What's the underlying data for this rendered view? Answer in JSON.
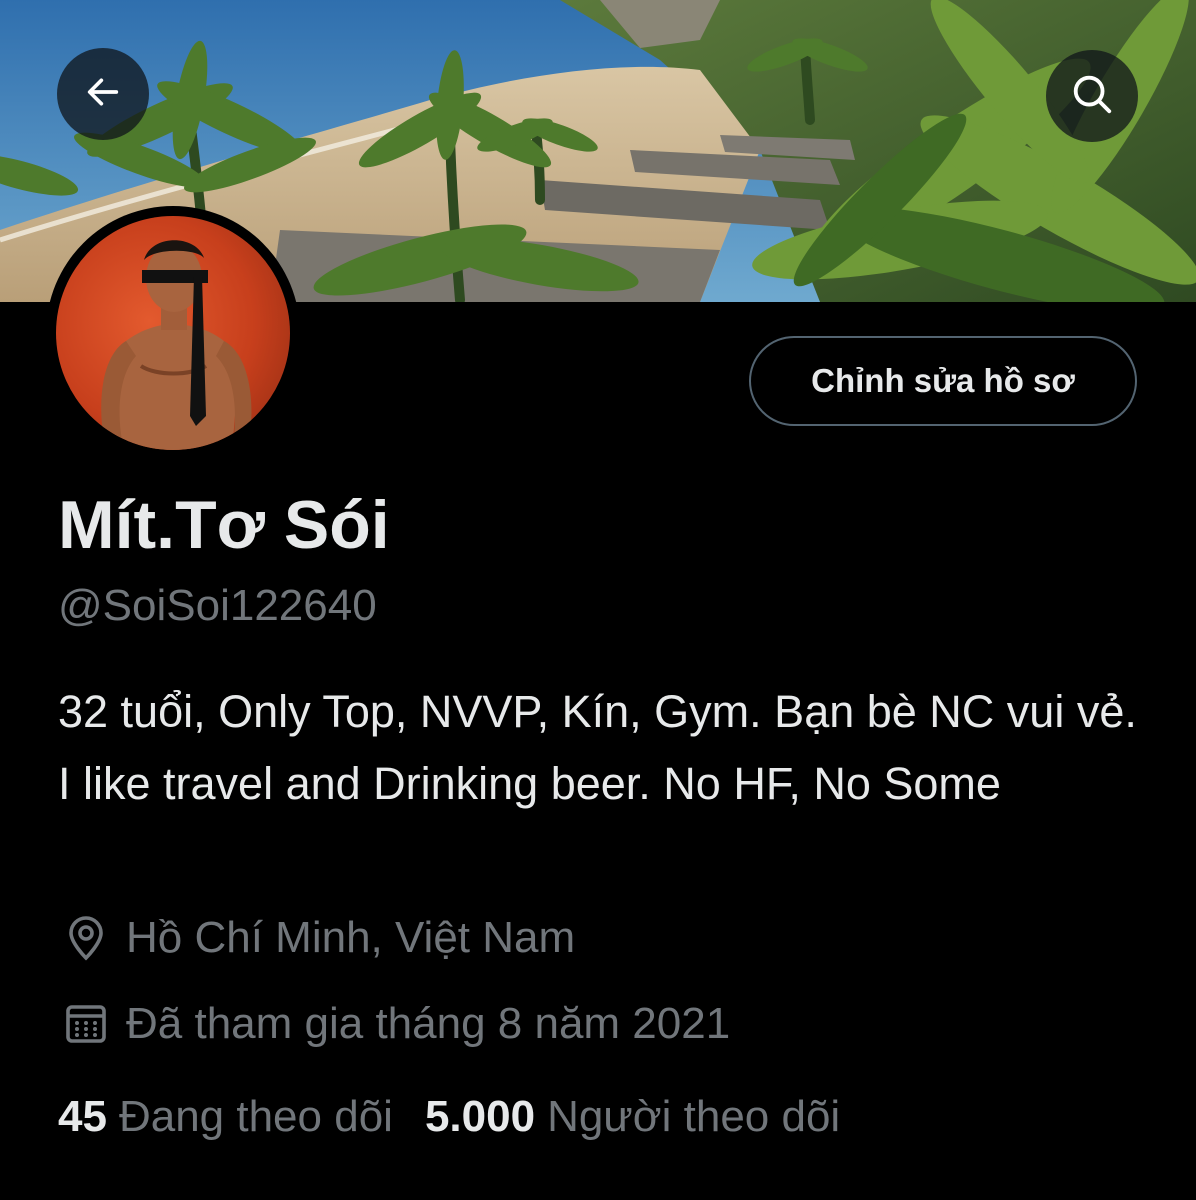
{
  "header": {
    "back_icon": "arrow-left-icon",
    "search_icon": "search-icon"
  },
  "profile": {
    "edit_button_label": "Chỉnh sửa hồ sơ",
    "display_name": "Mít.Tơ Sói",
    "handle": "@SoiSoi122640",
    "bio": "32 tuổi, Only Top, NVVP, Kín, Gym. Bạn bè NC vui vẻ. I like travel and Drinking beer. No HF, No Some",
    "location": "Hồ Chí Minh, Việt Nam",
    "location_icon": "location-pin-icon",
    "joined": "Đã tham gia tháng 8 năm 2021",
    "joined_icon": "calendar-icon"
  },
  "stats": {
    "following_count": "45",
    "following_label": "Đang theo dõi",
    "followers_count": "5.000",
    "followers_label": "Người theo dõi"
  },
  "colors": {
    "background": "#000000",
    "primary_text": "#e7e9ea",
    "secondary_text": "#71767b",
    "button_border": "#536471"
  }
}
